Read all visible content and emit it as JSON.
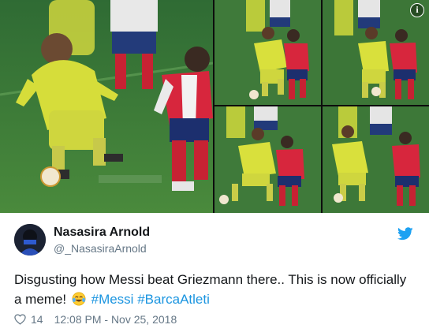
{
  "tweet": {
    "author_name": "Nasasira Arnold",
    "author_handle": "@_NasasiraArnold",
    "text_plain": "Disgusting how Messi beat Griezmann there.. This is now officially a meme!",
    "emoji": "tears-of-joy",
    "hashtags": [
      "#Messi",
      "#BarcaAtleti"
    ],
    "likes": "14",
    "timestamp": "12:08 PM - Nov 25, 2018"
  },
  "media": {
    "photo_count": 5,
    "info_icon_label": "i"
  },
  "icons": {
    "twitter": "twitter-bird-icon",
    "info": "info-icon",
    "like": "heart-icon",
    "emoji": "tears-of-joy-emoji-icon"
  },
  "colors": {
    "link": "#1b95e0",
    "muted": "#657786",
    "text": "#14171a",
    "twitter_blue": "#1da1f2",
    "pitch_green": "#3f7a3a",
    "barca_yellow": "#d9e03c",
    "atleti_red": "#d7263d"
  }
}
